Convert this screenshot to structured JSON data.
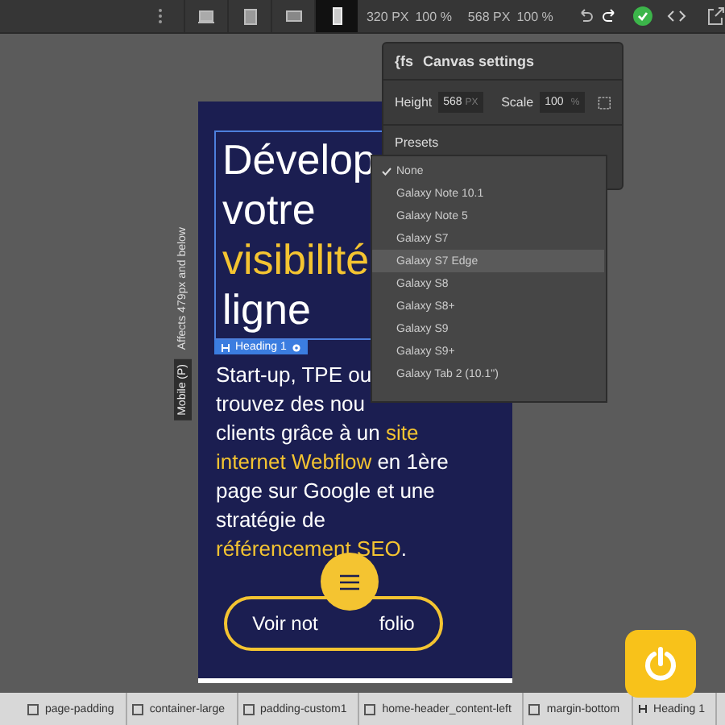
{
  "toolbar": {
    "devices": [
      {
        "kind": "desktop",
        "selected": false
      },
      {
        "kind": "tablet",
        "selected": false
      },
      {
        "kind": "landscape",
        "selected": false
      },
      {
        "kind": "phone",
        "selected": true
      }
    ],
    "width": {
      "value": "320",
      "unit": "PX",
      "zoom": "100",
      "zoom_unit": "%"
    },
    "height": {
      "value": "568",
      "unit": "PX",
      "zoom": "100",
      "zoom_unit": "%"
    }
  },
  "canvas_settings": {
    "icon_text": "{fs",
    "title": "Canvas settings",
    "height_label": "Height",
    "height_value": "568",
    "height_unit": "PX",
    "scale_label": "Scale",
    "scale_value": "100",
    "scale_unit": "%",
    "presets_label": "Presets",
    "presets": [
      {
        "label": "None",
        "selected": true,
        "hovered": false
      },
      {
        "label": "Galaxy Note 10.1",
        "selected": false,
        "hovered": false
      },
      {
        "label": "Galaxy Note 5",
        "selected": false,
        "hovered": false
      },
      {
        "label": "Galaxy S7",
        "selected": false,
        "hovered": false
      },
      {
        "label": "Galaxy S7 Edge",
        "selected": false,
        "hovered": true
      },
      {
        "label": "Galaxy S8",
        "selected": false,
        "hovered": false
      },
      {
        "label": "Galaxy S8+",
        "selected": false,
        "hovered": false
      },
      {
        "label": "Galaxy S9",
        "selected": false,
        "hovered": false
      },
      {
        "label": "Galaxy S9+",
        "selected": false,
        "hovered": false
      },
      {
        "label": "Galaxy Tab 2 (10.1\")",
        "selected": false,
        "hovered": false
      }
    ]
  },
  "breakpoint": {
    "note": "Affects 479px and below",
    "name": "Mobile (P)"
  },
  "page": {
    "heading_lines": [
      [
        {
          "text": "Dévelop",
          "highlight": false
        }
      ],
      [
        {
          "text": "votre",
          "highlight": false
        }
      ],
      [
        {
          "text": "visibilité",
          "highlight": true
        }
      ],
      [
        {
          "text": "ligne",
          "highlight": false
        }
      ]
    ],
    "selection_tag": "Heading 1",
    "body_lines": [
      [
        {
          "text": "Start-up, TPE ou",
          "highlight": false
        }
      ],
      [
        {
          "text": "trouvez des nou",
          "highlight": false
        }
      ],
      [
        {
          "text": "clients grâce à un ",
          "highlight": false
        },
        {
          "text": "site",
          "highlight": true
        }
      ],
      [
        {
          "text": "internet Webflow",
          "highlight": true
        },
        {
          "text": " en 1ère",
          "highlight": false
        }
      ],
      [
        {
          "text": "page sur Google et une",
          "highlight": false
        }
      ],
      [
        {
          "text": "stratégie de",
          "highlight": false
        }
      ],
      [
        {
          "text": "référencement SEO",
          "highlight": true
        },
        {
          "text": ".",
          "highlight": false
        }
      ]
    ],
    "button_parts": [
      "Voir not",
      "folio"
    ]
  },
  "breadcrumbs": [
    {
      "label": "page-padding",
      "kind": "box"
    },
    {
      "label": "container-large",
      "kind": "box"
    },
    {
      "label": "padding-custom1",
      "kind": "box"
    },
    {
      "label": "home-header_content-left",
      "kind": "box"
    },
    {
      "label": "margin-bottom",
      "kind": "box"
    },
    {
      "label": "Heading 1",
      "kind": "heading"
    }
  ]
}
